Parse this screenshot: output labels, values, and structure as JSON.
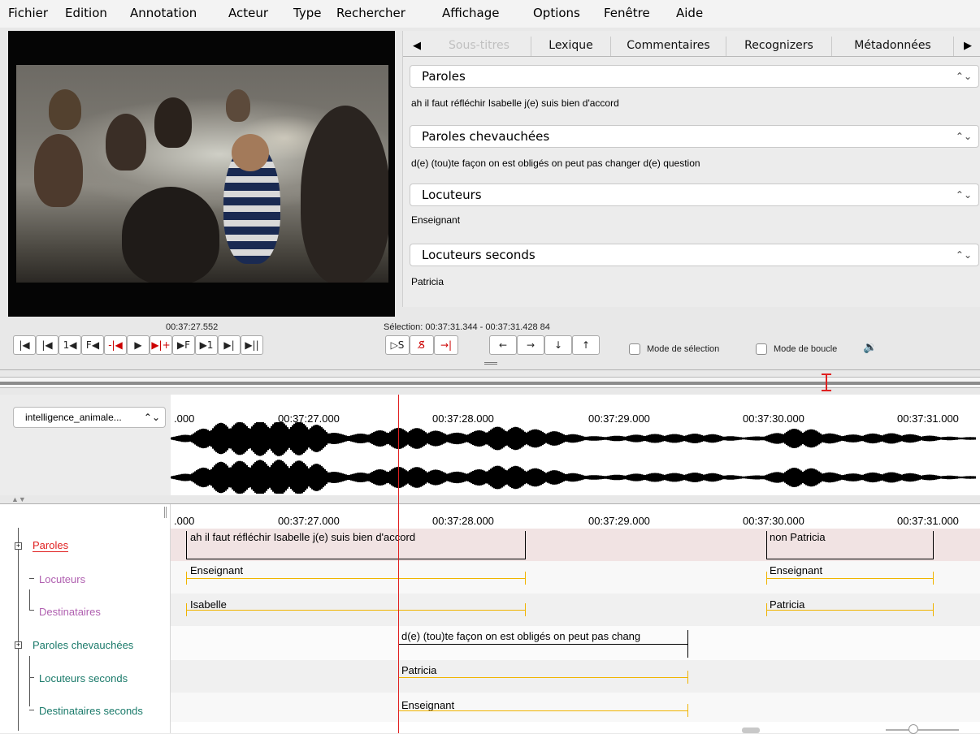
{
  "menu": [
    "Fichier",
    "Edition",
    "Annotation",
    "Acteur",
    "Type",
    "Rechercher",
    "Affichage",
    "Options",
    "Fenêtre",
    "Aide"
  ],
  "tabs": {
    "left_arrow": "◀",
    "right_arrow": "▶",
    "items": [
      "Sous-titres",
      "Lexique",
      "Commentaires",
      "Recognizers",
      "Métadonnées"
    ],
    "active": "Sous-titres"
  },
  "subtitles": [
    {
      "tier": "Paroles",
      "text": "ah il faut réfléchir Isabelle j(e) suis bien d'accord"
    },
    {
      "tier": "Paroles chevauchées",
      "text": "d(e) (tou)te façon on est obligés on peut pas changer d(e) question"
    },
    {
      "tier": "Locuteurs",
      "text": "Enseignant"
    },
    {
      "tier": "Locuteurs seconds",
      "text": "Patricia"
    }
  ],
  "player": {
    "time": "00:37:27.552",
    "selection": "Sélection: 00:37:31.344 - 00:37:31.428  84",
    "buttons": [
      "|◀",
      "|◀",
      "1◀",
      "F◀",
      "-|◀",
      "▶",
      "▶|+",
      "▶F",
      "▶1",
      "▶|",
      "▶||"
    ],
    "sel_buttons": [
      "▷S",
      "S̸",
      "→|"
    ],
    "nav_buttons": [
      "←",
      "→",
      "↓",
      "↑"
    ],
    "mode_selection": "Mode de sélection",
    "mode_boucle": "Mode de boucle",
    "volume_icon": "volume-icon"
  },
  "waveform": {
    "file": "intelligence_animale...",
    "ruler": [
      ".000",
      "00:37:27.000",
      "00:37:28.000",
      "00:37:29.000",
      "00:37:30.000",
      "00:37:31.000"
    ]
  },
  "timeline": {
    "ruler": [
      ".000",
      "00:37:27.000",
      "00:37:28.000",
      "00:37:29.000",
      "00:37:30.000",
      "00:37:31.000"
    ],
    "tiers": [
      {
        "name": "Paroles",
        "color": "#e02020",
        "annotations": [
          "ah il faut réfléchir Isabelle j(e) suis bien d'accord",
          "non Patricia"
        ]
      },
      {
        "name": "Locuteurs",
        "color": "#b060b0",
        "annotations": [
          "Enseignant",
          "Enseignant"
        ]
      },
      {
        "name": "Destinataires",
        "color": "#b060b0",
        "annotations": [
          "Isabelle",
          "Patricia"
        ]
      },
      {
        "name": "Paroles chevauchées",
        "color": "#1a7a6a",
        "annotations": [
          "d(e) (tou)te façon on est obligés on peut pas chang"
        ]
      },
      {
        "name": "Locuteurs seconds",
        "color": "#1a7a6a",
        "annotations": [
          "Patricia"
        ]
      },
      {
        "name": "Destinataires seconds",
        "color": "#1a7a6a",
        "annotations": [
          "Enseignant"
        ]
      }
    ]
  },
  "colors": {
    "playhead": "#e02020",
    "child_bar": "#f0b400"
  }
}
